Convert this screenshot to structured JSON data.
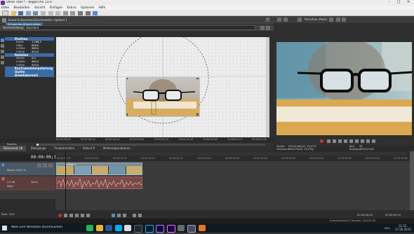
{
  "app": {
    "title": "Ohne Titel * - Vegas Pro 13.0",
    "menu": [
      "Datei",
      "Bearbeiten",
      "Ansicht",
      "Einfügen",
      "Extras",
      "Optionen",
      "Hilfe"
    ]
  },
  "pancrop": {
    "title": "Event-Schwenken/Zuschneiden: Spiltsel 1",
    "tab": "Schwenken/Zuschneiden",
    "preset_label": "Voreinstellung:",
    "preset_value": "Standard",
    "groups": [
      {
        "label": "Position",
        "props": [
          {
            "k": "Breite",
            "v": "1.166,3"
          },
          {
            "k": "Höhe",
            "v": "656,0"
          },
          {
            "k": "X-Mitte",
            "v": "960,0"
          },
          {
            "k": "Y-Mitte",
            "v": "540,0"
          }
        ]
      },
      {
        "label": "Rotation",
        "props": [
          {
            "k": "Winkel",
            "v": "0,0"
          },
          {
            "k": "X-Mitte",
            "v": "960,0"
          },
          {
            "k": "Y-Mitte",
            "v": "540,0"
          }
        ]
      },
      {
        "label": "Keyframeinterpolierung",
        "props": []
      },
      {
        "label": "Quelle",
        "props": []
      },
      {
        "label": "Arbeitsbereich",
        "props": []
      }
    ],
    "ruler_labels": [
      "00:00:00;00",
      "00:00:00;10",
      "00:00:00;20",
      "00:00:01;00",
      "00:00:01;10",
      "00:00:01;20",
      "00:00:02;00",
      "00:00:02;10",
      "00:00:02;20"
    ],
    "track_label": "Position",
    "track_label2": "Maske",
    "time": "00:00:00;00"
  },
  "preview": {
    "label": "Vorschau (Auto)",
    "project": "Projekt:",
    "project_value": "1920x1080x32, 29,970i",
    "preview_label": "Vorschau:",
    "preview_value": "480x270x32, 29,970p",
    "anzeige": "Anzeige:",
    "anzeige_value": "352x198x32",
    "frame_label": "Bild:",
    "frame_value": "28",
    "display_label": "Anzeige:",
    "display_value": "405x227x32"
  },
  "tabs": [
    "Dokument 18",
    "Übergänge",
    "Projektmedien",
    "Video FX",
    "Medienoperationen"
  ],
  "timeline": {
    "time": "00:00:00;10",
    "tracks": [
      {
        "type": "video",
        "name": "1",
        "level": "Ebene: 100,0 %"
      },
      {
        "type": "audio",
        "name": "2",
        "vol": "0,0 dB",
        "pan": "Mitte",
        "touch": "Touch"
      }
    ],
    "ruler": [
      "00:00:00;00",
      "00:00:05;00",
      "00:00:10;00",
      "00:00:15;00",
      "00:00:20;00",
      "00:00:25;00",
      "00:00:30;00",
      "00:00:35;00",
      "00:00:40;00",
      "00:00:45;00",
      "00:00:50;00",
      "00:00:55;00",
      "00:01:00;00"
    ],
    "clip_name": "Spiltsel 1",
    "current": "00:00:00;00",
    "rate": "Rate: 0,00",
    "end": "00:00:00;10",
    "tl_end": "00:00:00;10"
  },
  "status": {
    "left": "",
    "right": "Aufnahmezeit (2 Kanäle): 164:05:55"
  },
  "taskbar": {
    "search": "Web und Windows durchsuchen",
    "time": "11:52",
    "date": "27.06.2015",
    "lang": "DEU"
  }
}
